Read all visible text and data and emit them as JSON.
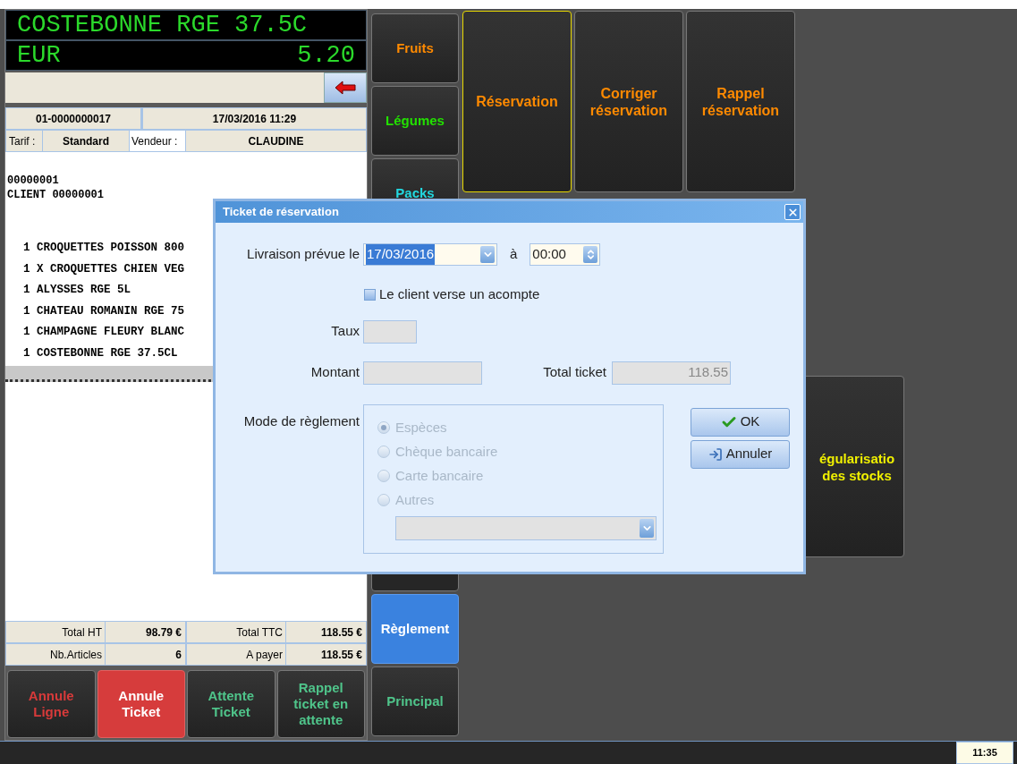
{
  "display": {
    "product": "COSTEBONNE RGE 37.5C",
    "currency": "EUR",
    "amount": "5.20"
  },
  "ticket": {
    "number": "01-0000000017",
    "datetime": "17/03/2016 11:29",
    "tarif_label": "Tarif :",
    "tarif": "Standard",
    "seller_label": "Vendeur :",
    "seller": "CLAUDINE"
  },
  "receipt": {
    "header_lines": [
      "00000001",
      "CLIENT 00000001"
    ],
    "items": [
      "1 CROQUETTES POISSON 800",
      "1 X CROQUETTES CHIEN VEG",
      "1 ALYSSES RGE 5L",
      "1 CHATEAU ROMANIN RGE 75",
      "1 CHAMPAGNE FLEURY BLANC",
      "1 COSTEBONNE RGE 37.5CL"
    ]
  },
  "totals": [
    {
      "label": "Total HT",
      "value": "98.79 €"
    },
    {
      "label": "Total TTC",
      "value": "118.55 €"
    },
    {
      "label": "Nb.Articles",
      "value": "6"
    },
    {
      "label": "A payer",
      "value": "118.55 €"
    }
  ],
  "ticket_buttons": [
    {
      "label": "Annule Ligne",
      "kind": "dark",
      "color": "#d83a3a"
    },
    {
      "label": "Annule Ticket",
      "kind": "red",
      "color": "#ffffff"
    },
    {
      "label": "Attente Ticket",
      "kind": "dark",
      "color": "#4fc48a"
    },
    {
      "label": "Rappel ticket en attente",
      "kind": "dark",
      "color": "#4fc48a"
    }
  ],
  "categories": [
    {
      "label": "Fruits",
      "kind": "dark",
      "color": "#ff8a00"
    },
    {
      "label": "Légumes",
      "kind": "dark",
      "color": "#22e000"
    },
    {
      "label": "Packs",
      "kind": "dark",
      "color": "#22d8e0"
    }
  ],
  "bottom_categories": [
    {
      "label": "Règlement",
      "kind": "blue",
      "color": "#ffffff"
    },
    {
      "label": "Principal",
      "kind": "dark",
      "color": "#4fc48a"
    }
  ],
  "actions": [
    {
      "label": "Réservation",
      "selected": true
    },
    {
      "label": "Corriger réservation",
      "selected": false
    },
    {
      "label": "Rappel réservation",
      "selected": false
    }
  ],
  "stock_button": {
    "label": "égularisatio des stocks"
  },
  "dialog": {
    "title": "Ticket de réservation",
    "delivery_label": "Livraison prévue le",
    "date": "17/03/2016",
    "at_label": "à",
    "time": "00:00",
    "deposit": {
      "label": "Le client verse un acompte",
      "checked": false
    },
    "rate_label": "Taux",
    "amount_label": "Montant",
    "total_label": "Total ticket",
    "total": "118.55",
    "payment_label": "Mode de règlement",
    "payment_disabled": true,
    "payment_options": [
      {
        "label": "Espèces",
        "selected": true
      },
      {
        "label": "Chèque bancaire",
        "selected": false
      },
      {
        "label": "Carte bancaire",
        "selected": false
      },
      {
        "label": "Autres",
        "selected": false
      }
    ],
    "ok": "OK",
    "cancel": "Annuler"
  },
  "status_bar": {
    "clock": "11:35"
  }
}
